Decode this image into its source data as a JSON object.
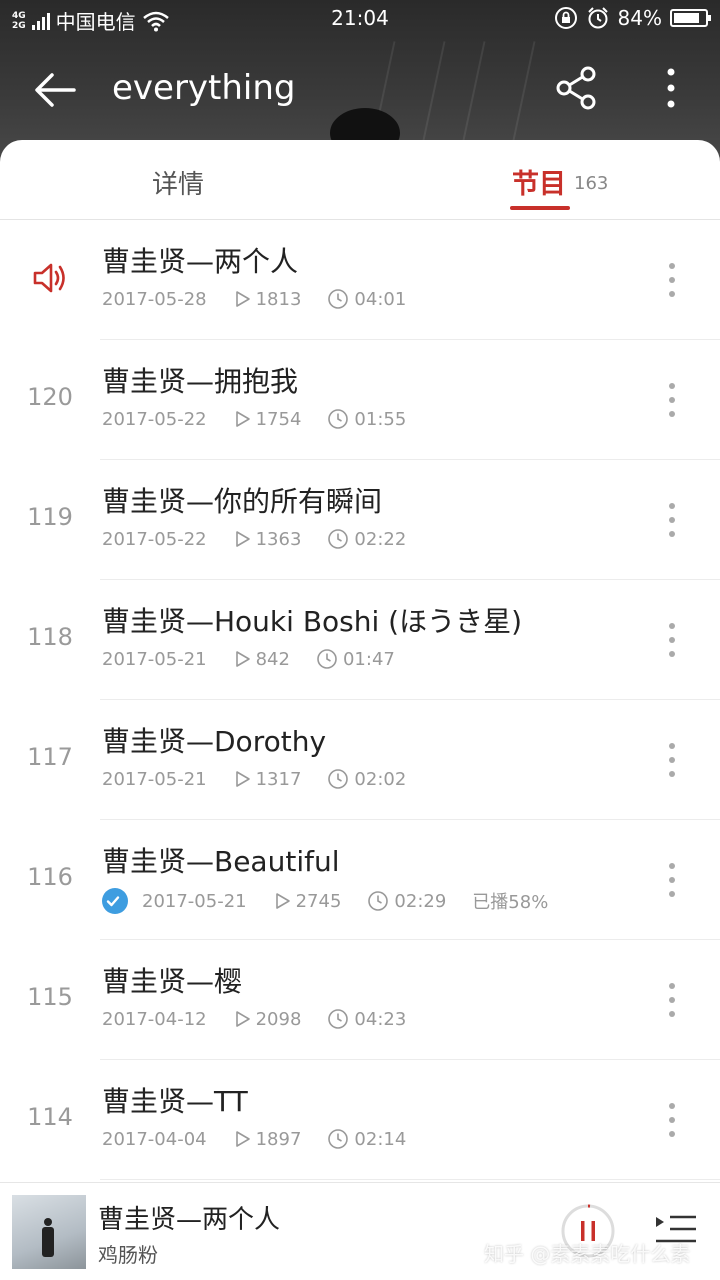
{
  "status_bar": {
    "network_top": "4G",
    "network_bottom": "2G",
    "carrier": "中国电信",
    "time": "21:04",
    "battery_text": "84%",
    "battery_level": 0.84
  },
  "toolbar": {
    "title": "everything"
  },
  "tabs": {
    "detail": "详情",
    "programs": "节目",
    "programs_count": "163"
  },
  "episodes": [
    {
      "number": "",
      "playing": true,
      "title": "曹圭贤—两个人",
      "date": "2017-05-28",
      "plays": "1813",
      "duration": "04:01",
      "progress": ""
    },
    {
      "number": "120",
      "playing": false,
      "title": "曹圭贤—拥抱我",
      "date": "2017-05-22",
      "plays": "1754",
      "duration": "01:55",
      "progress": ""
    },
    {
      "number": "119",
      "playing": false,
      "title": "曹圭贤—你的所有瞬间",
      "date": "2017-05-22",
      "plays": "1363",
      "duration": "02:22",
      "progress": ""
    },
    {
      "number": "118",
      "playing": false,
      "title": "曹圭贤—Houki Boshi (ほうき星)",
      "date": "2017-05-21",
      "plays": "842",
      "duration": "01:47",
      "progress": ""
    },
    {
      "number": "117",
      "playing": false,
      "title": "曹圭贤—Dorothy",
      "date": "2017-05-21",
      "plays": "1317",
      "duration": "02:02",
      "progress": ""
    },
    {
      "number": "116",
      "playing": false,
      "downloaded": true,
      "title": "曹圭贤—Beautiful",
      "date": "2017-05-21",
      "plays": "2745",
      "duration": "02:29",
      "progress": "已播58%"
    },
    {
      "number": "115",
      "playing": false,
      "title": "曹圭贤—樱",
      "date": "2017-04-12",
      "plays": "2098",
      "duration": "04:23",
      "progress": ""
    },
    {
      "number": "114",
      "playing": false,
      "title": "曹圭贤—TT",
      "date": "2017-04-04",
      "plays": "1897",
      "duration": "02:14",
      "progress": ""
    }
  ],
  "player": {
    "title": "曹圭贤—两个人",
    "subtitle": "鸡肠粉"
  },
  "watermark": "知乎 @素素素吃什么素",
  "colors": {
    "accent": "#c8302a",
    "check": "#3e9de0"
  }
}
